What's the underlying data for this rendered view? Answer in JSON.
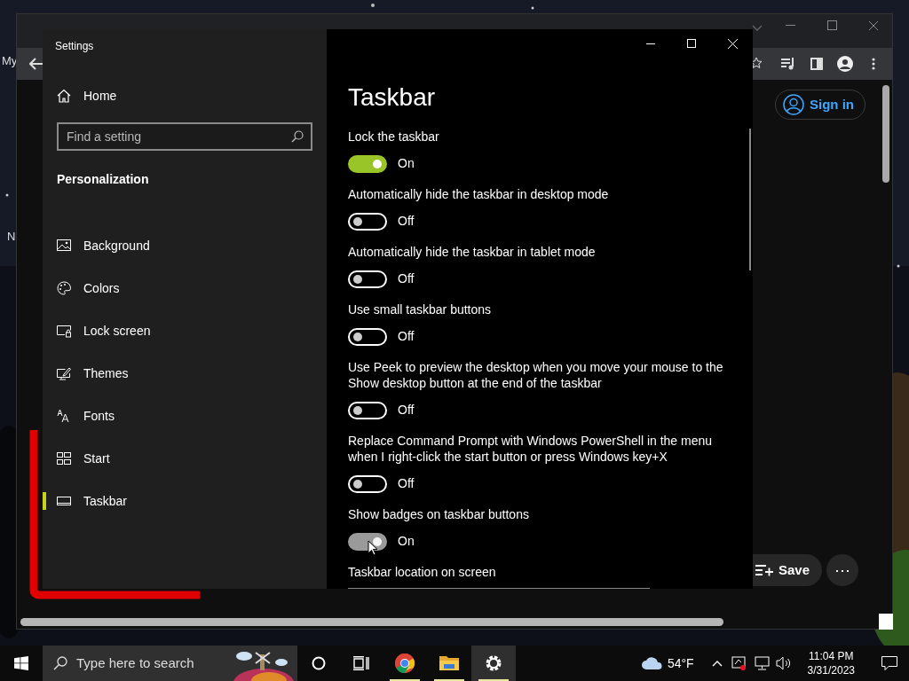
{
  "desktop": {
    "fragments": [
      "My",
      "N"
    ]
  },
  "browser": {
    "sign_in": "Sign in",
    "save": "Save",
    "more": "⋯"
  },
  "settings": {
    "title": "Settings",
    "home": "Home",
    "search": {
      "placeholder": "Find a setting"
    },
    "section": "Personalization",
    "nav": [
      {
        "label": "Background",
        "selected": false
      },
      {
        "label": "Colors",
        "selected": false
      },
      {
        "label": "Lock screen",
        "selected": false
      },
      {
        "label": "Themes",
        "selected": false
      },
      {
        "label": "Fonts",
        "selected": false
      },
      {
        "label": "Start",
        "selected": false
      },
      {
        "label": "Taskbar",
        "selected": true
      }
    ],
    "page_title": "Taskbar",
    "options": [
      {
        "label": "Lock the taskbar",
        "on": true,
        "pressed": false,
        "state_text": "On"
      },
      {
        "label": "Automatically hide the taskbar in desktop mode",
        "on": false,
        "pressed": false,
        "state_text": "Off"
      },
      {
        "label": "Automatically hide the taskbar in tablet mode",
        "on": false,
        "pressed": false,
        "state_text": "Off"
      },
      {
        "label": "Use small taskbar buttons",
        "on": false,
        "pressed": false,
        "state_text": "Off"
      },
      {
        "label": "Use Peek to preview the desktop when you move your mouse to the Show desktop button at the end of the taskbar",
        "on": false,
        "pressed": false,
        "state_text": "Off"
      },
      {
        "label": "Replace Command Prompt with Windows PowerShell in the menu when I right-click the start button or press Windows key+X",
        "on": false,
        "pressed": false,
        "state_text": "Off"
      },
      {
        "label": "Show badges on taskbar buttons",
        "on": true,
        "pressed": true,
        "state_text": "On"
      }
    ],
    "location_label": "Taskbar location on screen"
  },
  "taskbar": {
    "search_placeholder": "Type here to search",
    "apps": [
      {
        "running": true,
        "selected": false
      },
      {
        "running": true,
        "selected": false
      },
      {
        "running": true,
        "selected": true
      }
    ],
    "weather": "54°F",
    "time": "11:04 PM",
    "date": "3/31/2023"
  }
}
